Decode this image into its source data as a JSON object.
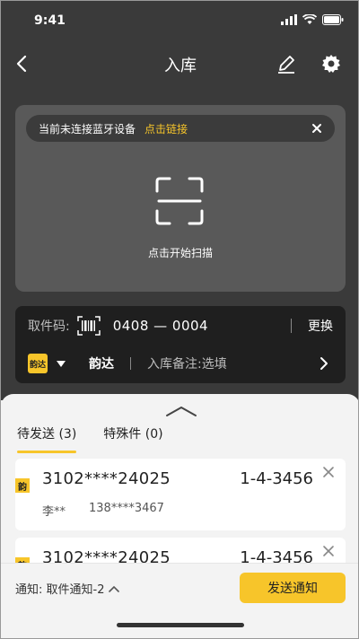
{
  "status_bar": {
    "time": "9:41"
  },
  "navbar": {
    "title": "入库"
  },
  "scan": {
    "bluetooth_text": "当前未连接蓝牙设备",
    "bluetooth_link": "点击链接",
    "scan_label": "点击开始扫描"
  },
  "code_panel": {
    "label": "取件码:",
    "code": "0408 — 0004",
    "swap": "更换",
    "courier_logo": "韵达",
    "courier_name": "韵达",
    "remark_label": "入库备注:",
    "remark_value": "选填"
  },
  "tabs": [
    {
      "label": "待发送 (3)",
      "active": true
    },
    {
      "label": "特殊件 (0)",
      "active": false
    }
  ],
  "items": [
    {
      "tag": "韵",
      "tracking": "3102****24025",
      "shelf": "1-4-3456",
      "name": "李**",
      "phone": "138****3467"
    },
    {
      "tag": "韵",
      "tracking": "3102****24025",
      "shelf": "1-4-3456",
      "name": "",
      "phone": ""
    }
  ],
  "bottom_bar": {
    "notify_label": "通知: 取件通知-2",
    "send_label": "发送通知"
  },
  "colors": {
    "accent": "#f7c52a",
    "dark_bg": "#3a3a3a",
    "panel_bg": "#1f1f1f"
  }
}
